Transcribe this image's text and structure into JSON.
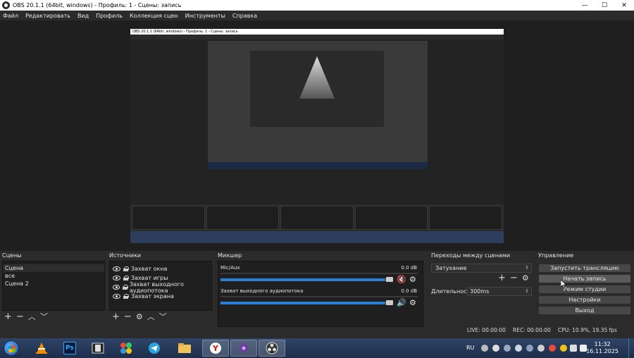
{
  "window": {
    "title": "OBS 20.1.1 (64bit, windows) - Профиль: 1 - Сцены: запись",
    "min": "—",
    "max": "☐",
    "close": "✕"
  },
  "menu": [
    "Файл",
    "Редактировать",
    "Вид",
    "Профиль",
    "Коллекция сцен",
    "Инструменты",
    "Справка"
  ],
  "scenes": {
    "title": "Сцены",
    "items": [
      "Сцена",
      "все",
      "Сцена 2"
    ]
  },
  "sources": {
    "title": "Источники",
    "items": [
      "Захват окна",
      "Захват игры",
      "Захват выходного аудиопотока",
      "Захват экрана"
    ]
  },
  "mixer": {
    "title": "Микшер",
    "channels": [
      {
        "name": "Mic/Aux",
        "db": "0.0 dB",
        "level": 0.97,
        "muted": true
      },
      {
        "name": "Захват выходного аудиопотока",
        "db": "0.0 dB",
        "level": 0.97,
        "muted": false
      }
    ]
  },
  "transitions": {
    "title": "Переходы между сценами",
    "selected": "Затухание",
    "duration_label": "Длительность",
    "duration_value": "300ms"
  },
  "controls": {
    "title": "Управление",
    "buttons": [
      "Запустить трансляцию",
      "Начать запись",
      "Режим студии",
      "Настройки",
      "Выход"
    ]
  },
  "status": {
    "live": "LIVE: 00:00:00",
    "rec": "REC: 00:00:00",
    "cpu": "CPU: 10.9%, 19.35 fps"
  },
  "taskbar": {
    "lang": "RU",
    "time": "11:32",
    "date": "16.11.2025",
    "apps": [
      "vlc-icon",
      "photoshop-icon",
      "video-editor-icon",
      "colorful-app-icon",
      "telegram-icon",
      "file-explorer-icon",
      "yandex-browser-icon",
      "vs-icon",
      "obs-icon"
    ]
  },
  "colors": {
    "accent_blue": "#2d7fd6",
    "mute_red": "#d62d2d",
    "panel_bg": "#1f1f1f",
    "window_bg": "#2b2b2b"
  }
}
